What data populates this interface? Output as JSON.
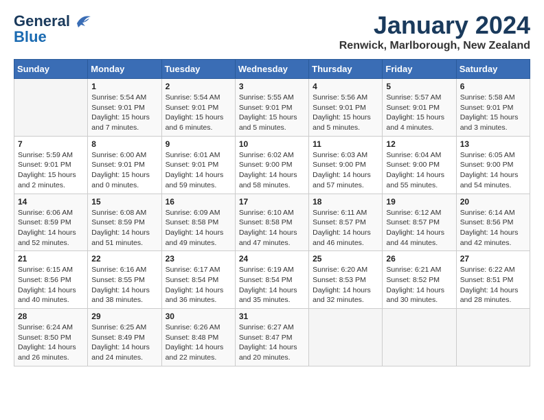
{
  "header": {
    "logo_general": "General",
    "logo_blue": "Blue",
    "month_title": "January 2024",
    "location": "Renwick, Marlborough, New Zealand"
  },
  "weekdays": [
    "Sunday",
    "Monday",
    "Tuesday",
    "Wednesday",
    "Thursday",
    "Friday",
    "Saturday"
  ],
  "weeks": [
    [
      {
        "day": "",
        "info": ""
      },
      {
        "day": "1",
        "info": "Sunrise: 5:54 AM\nSunset: 9:01 PM\nDaylight: 15 hours\nand 7 minutes."
      },
      {
        "day": "2",
        "info": "Sunrise: 5:54 AM\nSunset: 9:01 PM\nDaylight: 15 hours\nand 6 minutes."
      },
      {
        "day": "3",
        "info": "Sunrise: 5:55 AM\nSunset: 9:01 PM\nDaylight: 15 hours\nand 5 minutes."
      },
      {
        "day": "4",
        "info": "Sunrise: 5:56 AM\nSunset: 9:01 PM\nDaylight: 15 hours\nand 5 minutes."
      },
      {
        "day": "5",
        "info": "Sunrise: 5:57 AM\nSunset: 9:01 PM\nDaylight: 15 hours\nand 4 minutes."
      },
      {
        "day": "6",
        "info": "Sunrise: 5:58 AM\nSunset: 9:01 PM\nDaylight: 15 hours\nand 3 minutes."
      }
    ],
    [
      {
        "day": "7",
        "info": "Sunrise: 5:59 AM\nSunset: 9:01 PM\nDaylight: 15 hours\nand 2 minutes."
      },
      {
        "day": "8",
        "info": "Sunrise: 6:00 AM\nSunset: 9:01 PM\nDaylight: 15 hours\nand 0 minutes."
      },
      {
        "day": "9",
        "info": "Sunrise: 6:01 AM\nSunset: 9:01 PM\nDaylight: 14 hours\nand 59 minutes."
      },
      {
        "day": "10",
        "info": "Sunrise: 6:02 AM\nSunset: 9:00 PM\nDaylight: 14 hours\nand 58 minutes."
      },
      {
        "day": "11",
        "info": "Sunrise: 6:03 AM\nSunset: 9:00 PM\nDaylight: 14 hours\nand 57 minutes."
      },
      {
        "day": "12",
        "info": "Sunrise: 6:04 AM\nSunset: 9:00 PM\nDaylight: 14 hours\nand 55 minutes."
      },
      {
        "day": "13",
        "info": "Sunrise: 6:05 AM\nSunset: 9:00 PM\nDaylight: 14 hours\nand 54 minutes."
      }
    ],
    [
      {
        "day": "14",
        "info": "Sunrise: 6:06 AM\nSunset: 8:59 PM\nDaylight: 14 hours\nand 52 minutes."
      },
      {
        "day": "15",
        "info": "Sunrise: 6:08 AM\nSunset: 8:59 PM\nDaylight: 14 hours\nand 51 minutes."
      },
      {
        "day": "16",
        "info": "Sunrise: 6:09 AM\nSunset: 8:58 PM\nDaylight: 14 hours\nand 49 minutes."
      },
      {
        "day": "17",
        "info": "Sunrise: 6:10 AM\nSunset: 8:58 PM\nDaylight: 14 hours\nand 47 minutes."
      },
      {
        "day": "18",
        "info": "Sunrise: 6:11 AM\nSunset: 8:57 PM\nDaylight: 14 hours\nand 46 minutes."
      },
      {
        "day": "19",
        "info": "Sunrise: 6:12 AM\nSunset: 8:57 PM\nDaylight: 14 hours\nand 44 minutes."
      },
      {
        "day": "20",
        "info": "Sunrise: 6:14 AM\nSunset: 8:56 PM\nDaylight: 14 hours\nand 42 minutes."
      }
    ],
    [
      {
        "day": "21",
        "info": "Sunrise: 6:15 AM\nSunset: 8:56 PM\nDaylight: 14 hours\nand 40 minutes."
      },
      {
        "day": "22",
        "info": "Sunrise: 6:16 AM\nSunset: 8:55 PM\nDaylight: 14 hours\nand 38 minutes."
      },
      {
        "day": "23",
        "info": "Sunrise: 6:17 AM\nSunset: 8:54 PM\nDaylight: 14 hours\nand 36 minutes."
      },
      {
        "day": "24",
        "info": "Sunrise: 6:19 AM\nSunset: 8:54 PM\nDaylight: 14 hours\nand 35 minutes."
      },
      {
        "day": "25",
        "info": "Sunrise: 6:20 AM\nSunset: 8:53 PM\nDaylight: 14 hours\nand 32 minutes."
      },
      {
        "day": "26",
        "info": "Sunrise: 6:21 AM\nSunset: 8:52 PM\nDaylight: 14 hours\nand 30 minutes."
      },
      {
        "day": "27",
        "info": "Sunrise: 6:22 AM\nSunset: 8:51 PM\nDaylight: 14 hours\nand 28 minutes."
      }
    ],
    [
      {
        "day": "28",
        "info": "Sunrise: 6:24 AM\nSunset: 8:50 PM\nDaylight: 14 hours\nand 26 minutes."
      },
      {
        "day": "29",
        "info": "Sunrise: 6:25 AM\nSunset: 8:49 PM\nDaylight: 14 hours\nand 24 minutes."
      },
      {
        "day": "30",
        "info": "Sunrise: 6:26 AM\nSunset: 8:48 PM\nDaylight: 14 hours\nand 22 minutes."
      },
      {
        "day": "31",
        "info": "Sunrise: 6:27 AM\nSunset: 8:47 PM\nDaylight: 14 hours\nand 20 minutes."
      },
      {
        "day": "",
        "info": ""
      },
      {
        "day": "",
        "info": ""
      },
      {
        "day": "",
        "info": ""
      }
    ]
  ]
}
